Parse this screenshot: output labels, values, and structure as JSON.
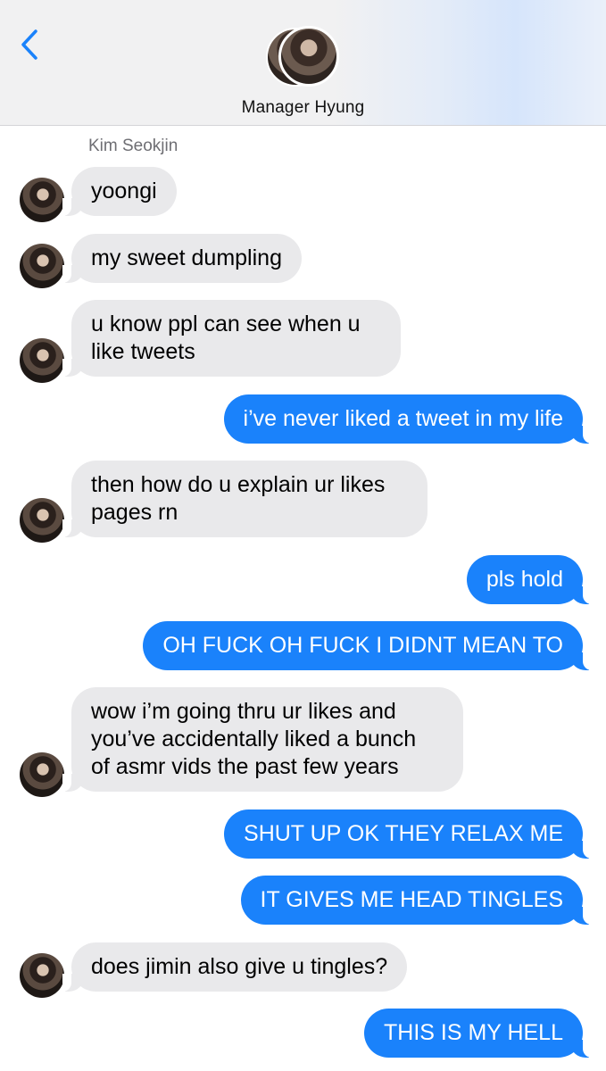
{
  "header": {
    "contact_name": "Manager Hyung"
  },
  "conversation": {
    "sender_name": "Kim Seokjin",
    "messages": [
      {
        "direction": "incoming",
        "lines": [
          "yoongi"
        ]
      },
      {
        "direction": "incoming",
        "lines": [
          "my sweet dumpling"
        ]
      },
      {
        "direction": "incoming",
        "lines": [
          "u know ppl can see when u",
          "like tweets"
        ]
      },
      {
        "direction": "outgoing",
        "lines": [
          "i’ve never liked a tweet in my life"
        ]
      },
      {
        "direction": "incoming",
        "lines": [
          "then how do u explain ur likes",
          "pages rn"
        ]
      },
      {
        "direction": "outgoing",
        "lines": [
          "pls hold"
        ]
      },
      {
        "direction": "outgoing",
        "lines": [
          "OH FUCK OH FUCK I DIDNT MEAN TO"
        ]
      },
      {
        "direction": "incoming",
        "lines": [
          "wow i’m going thru ur likes and",
          "you’ve accidentally liked a bunch",
          "of asmr vids the past few years"
        ]
      },
      {
        "direction": "outgoing",
        "lines": [
          "SHUT UP OK THEY RELAX ME"
        ]
      },
      {
        "direction": "outgoing",
        "lines": [
          "IT GIVES ME HEAD TINGLES"
        ]
      },
      {
        "direction": "incoming",
        "lines": [
          "does jimin also give u tingles?"
        ]
      },
      {
        "direction": "outgoing",
        "lines": [
          "THIS IS MY HELL"
        ]
      }
    ]
  },
  "colors": {
    "outgoing_bubble": "#1a82fb",
    "incoming_bubble": "#e9e9eb",
    "back_chevron": "#1a82fb"
  },
  "icons": {
    "back": "chevron-left-icon"
  }
}
